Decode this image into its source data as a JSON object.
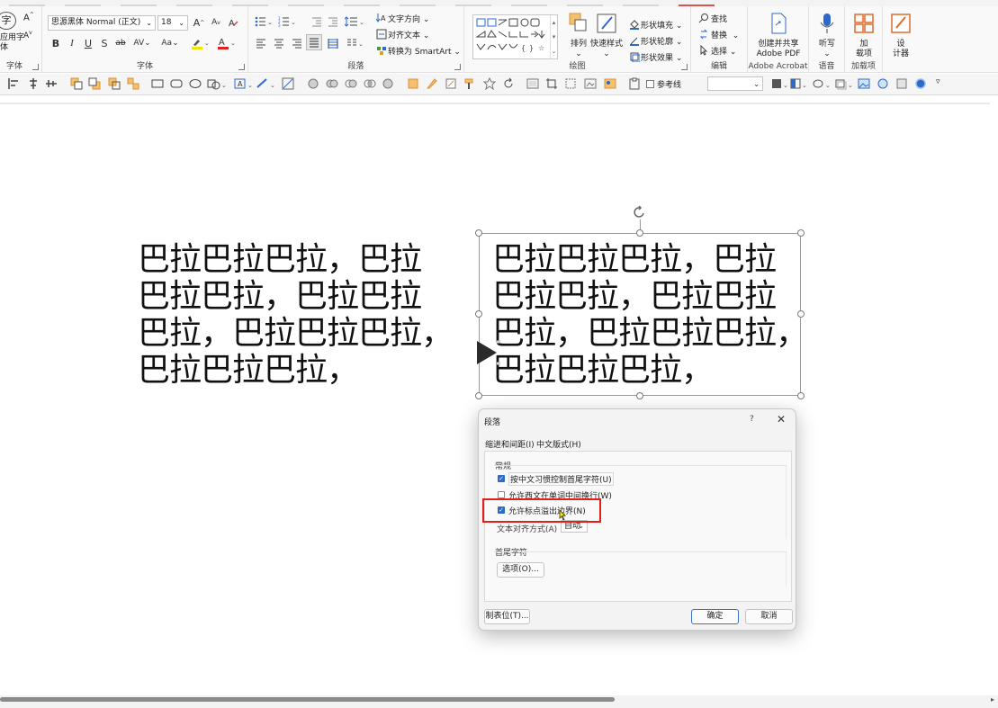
{
  "ribbon": {
    "font_group": {
      "label": "字体",
      "font_name": "思源黑体 Normal (正文)",
      "font_size": "18",
      "left_partial_label": "字体",
      "apply_font_label": "应用字\n体"
    },
    "paragraph_group": {
      "label": "段落",
      "text_direction": "文字方向",
      "align_text": "对齐文本",
      "convert_smartart": "转换为 SmartArt"
    },
    "drawing_group": {
      "label": "绘图",
      "arrange": "排列",
      "quick_styles": "快速样式",
      "shape_fill": "形状填充",
      "shape_outline": "形状轮廓",
      "shape_effects": "形状效果"
    },
    "editing_group": {
      "label": "编辑",
      "find": "查找",
      "replace": "替换",
      "select": "选择"
    },
    "acrobat_group": {
      "label": "Adobe Acrobat",
      "create_share": "创建并共享\nAdobe PDF"
    },
    "voice_group": {
      "label": "语音",
      "dictate": "听写"
    },
    "addins_group": {
      "label": "加载项",
      "addins": "加\n载项"
    },
    "designer": {
      "label": "设\n计器"
    }
  },
  "quick_toolbar": {
    "reference_line_label": "参考线"
  },
  "slide": {
    "left_text": "巴拉巴拉巴拉，巴拉\n巴拉巴拉，巴拉巴拉\n巴拉，巴拉巴拉巴拉，\n巴拉巴拉巴拉，",
    "right_text": "巴拉巴拉巴拉，巴拉\n巴拉巴拉，巴拉巴拉\n巴拉，巴拉巴拉巴拉，\n巴拉巴拉巴拉，"
  },
  "dialog": {
    "title": "段落",
    "help": "?",
    "close": "✕",
    "tabs": [
      {
        "label": "缩进和间距(I)",
        "active": false
      },
      {
        "label": "中文版式(H)",
        "active": true
      }
    ],
    "general_section": "常规",
    "options": [
      {
        "label": "按中文习惯控制首尾字符(U)",
        "checked": true
      },
      {
        "label": "允许西文在单词中间换行(W)",
        "checked": false
      },
      {
        "label": "允许标点溢出边界(N)",
        "checked": true
      }
    ],
    "text_align_label": "文本对齐方式(A)",
    "text_align_value": "自动",
    "first_last_section": "首尾字符",
    "options_button": "选项(O)...",
    "tabs_button": "制表位(T)...",
    "ok_button": "确定",
    "cancel_button": "取消"
  },
  "colors": {
    "highlight": "#e1201e",
    "checkbox_checked": "#2c69c9",
    "ok_border": "#3c70c0"
  }
}
